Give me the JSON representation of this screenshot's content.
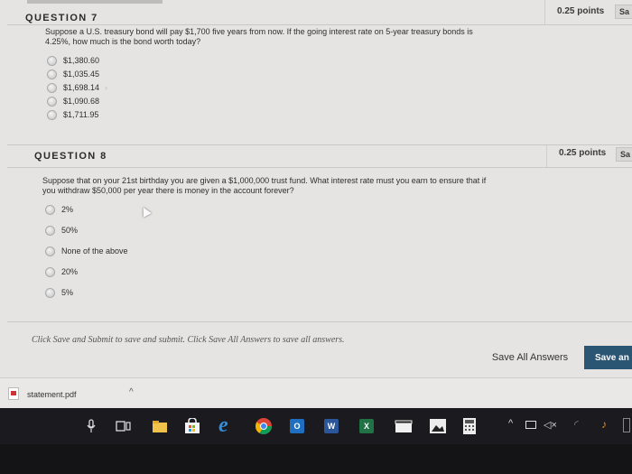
{
  "q7": {
    "title": "QUESTION 7",
    "points": "0.25 points",
    "save_label": "Sa",
    "text_line1": "Suppose a U.S. treasury bond will pay $1,700 five years from now. If the going interest rate on 5-year treasury bonds is",
    "text_line2": "4.25%, how much is the bond worth today?",
    "options": [
      "$1,380.60",
      "$1,035.45",
      "$1,698.14",
      "$1,090.68",
      "$1,711.95"
    ]
  },
  "q8": {
    "title": "QUESTION 8",
    "points": "0.25 points",
    "save_label": "Sa",
    "text_line1": "Suppose that on your 21st birthday you are given a $1,000,000 trust fund. What interest rate must you earn to ensure that if",
    "text_line2": "you withdraw $50,000 per year there is money in the account forever?",
    "options": [
      "2%",
      "50%",
      "None of the above",
      "20%",
      "5%"
    ]
  },
  "footer": {
    "instruction": "Click Save and Submit to save and submit. Click Save All Answers to save all answers.",
    "save_all": "Save All Answers",
    "save_submit": "Save an"
  },
  "download": {
    "filename": "statement.pdf",
    "chevron": "^"
  },
  "taskbar": {
    "icons": [
      "microphone-icon",
      "task-view-icon",
      "file-explorer-icon",
      "store-icon",
      "edge-icon",
      "chrome-icon",
      "outlook-icon",
      "word-icon",
      "excel-icon",
      "media-icon",
      "photos-icon",
      "calculator-icon"
    ],
    "word_label": "W",
    "excel_label": "X",
    "outlook_label": "O"
  }
}
